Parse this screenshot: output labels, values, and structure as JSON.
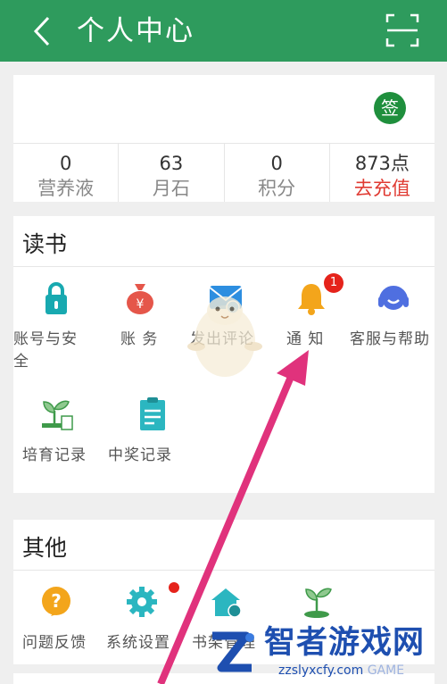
{
  "header": {
    "title": "个人中心",
    "icons": [
      "back-arrow-icon",
      "scan-icon"
    ],
    "bg_color": "#2e9b5d"
  },
  "user": {
    "sign_label": "签"
  },
  "stats": [
    {
      "value": "0",
      "label": "营养液",
      "highlight": false
    },
    {
      "value": "63",
      "label": "月石",
      "highlight": false
    },
    {
      "value": "0",
      "label": "积分",
      "highlight": false
    },
    {
      "value": "873点",
      "label": "去充值",
      "highlight": true
    }
  ],
  "reading": {
    "title": "读书",
    "items": [
      {
        "label": "账号与安全",
        "icon": "lock-icon"
      },
      {
        "label": "账 务",
        "icon": "money-bag-icon"
      },
      {
        "label": "发出评论",
        "icon": "envelope-icon"
      },
      {
        "label": "通 知",
        "icon": "bell-icon",
        "badge": "1"
      },
      {
        "label": "客服与帮助",
        "icon": "headset-icon"
      },
      {
        "label": "培育记录",
        "icon": "sprout-icon"
      },
      {
        "label": "中奖记录",
        "icon": "clipboard-icon"
      }
    ]
  },
  "other": {
    "title": "其他",
    "items": [
      {
        "label": "问题反馈",
        "icon": "question-icon"
      },
      {
        "label": "系统设置",
        "icon": "gear-icon"
      },
      {
        "label": "书架管理",
        "icon": "house-gear-icon"
      },
      {
        "label": "",
        "icon": "seedling-icon"
      }
    ]
  },
  "watermark": {
    "name": "智者游戏网",
    "url": "zzslyxcfy.com",
    "sub": "GAME"
  },
  "colors": {
    "accent_red": "#e03a32",
    "badge_red": "#e5231b",
    "icon_green": "#1f8f3d",
    "logo_blue": "#1e4fb0"
  }
}
